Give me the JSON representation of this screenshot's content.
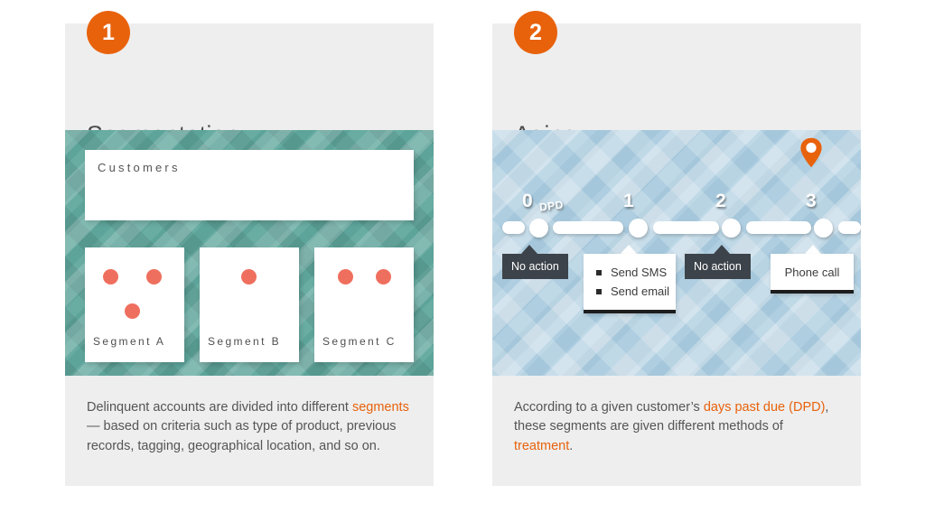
{
  "theme": {
    "accent": "#e8620c",
    "panel_bg": "#eeeeee",
    "teal": "#5fa79d",
    "blue": "#a8cade",
    "dot_red": "#ef6f5e",
    "dark_callout": "#3d434a",
    "text": "#555555"
  },
  "panels": [
    {
      "badge": "1",
      "title": "Segmentation",
      "graphic": {
        "kind": "segmentation-diagram",
        "customers_label": "Customers",
        "segments": [
          {
            "name": "Segment A",
            "dots": 3
          },
          {
            "name": "Segment B",
            "dots": 1
          },
          {
            "name": "Segment C",
            "dots": 2
          }
        ]
      },
      "caption": {
        "parts": [
          {
            "text": "Delinquent accounts are divided into different ",
            "highlight": false
          },
          {
            "text": "segments",
            "highlight": true
          },
          {
            "text": " — based on criteria such as type of product, previous records, tagging, geographical location, and so on.",
            "highlight": false
          }
        ]
      }
    },
    {
      "badge": "2",
      "title": "Aging",
      "graphic": {
        "kind": "aging-timeline",
        "unit_label": "DPD",
        "pin_at": "3",
        "milestones": [
          {
            "label": "0",
            "action": "No action",
            "style": "dark"
          },
          {
            "label": "1",
            "action": "Send SMS\nSend email",
            "style": "light",
            "items": [
              "Send SMS",
              "Send email"
            ]
          },
          {
            "label": "2",
            "action": "No action",
            "style": "dark"
          },
          {
            "label": "3",
            "action": "Phone call",
            "style": "light",
            "items": [
              "Phone call"
            ]
          }
        ]
      },
      "caption": {
        "parts": [
          {
            "text": "According to a given customer’s ",
            "highlight": false
          },
          {
            "text": "days past due (DPD)",
            "highlight": true
          },
          {
            "text": ", these segments are given different methods of ",
            "highlight": false
          },
          {
            "text": "treatment",
            "highlight": true
          },
          {
            "text": ".",
            "highlight": false
          }
        ]
      }
    }
  ]
}
